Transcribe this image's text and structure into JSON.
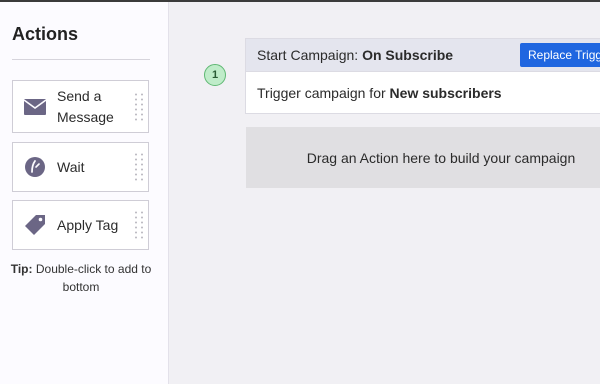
{
  "sidebar": {
    "title": "Actions",
    "items": [
      {
        "label_line1": "Send a",
        "label_line2": "Message",
        "icon": "envelope-icon"
      },
      {
        "label": "Wait",
        "icon": "clock-icon"
      },
      {
        "label": "Apply Tag",
        "icon": "tag-icon"
      }
    ],
    "tip_label": "Tip:",
    "tip_text": "Double-click to add to bottom"
  },
  "canvas": {
    "step_number": "1",
    "trigger": {
      "title_prefix": "Start Campaign:",
      "title_value": "On Subscribe",
      "replace_button": "Replace Trigger",
      "body_prefix": "Trigger campaign for",
      "body_value": "New subscribers"
    },
    "drop_zone_text": "Drag an Action here to build your campaign"
  },
  "colors": {
    "accent": "#1f66e0",
    "icon": "#6b6685",
    "step_badge_bg": "#bfecc9",
    "step_badge_border": "#5fb873"
  }
}
